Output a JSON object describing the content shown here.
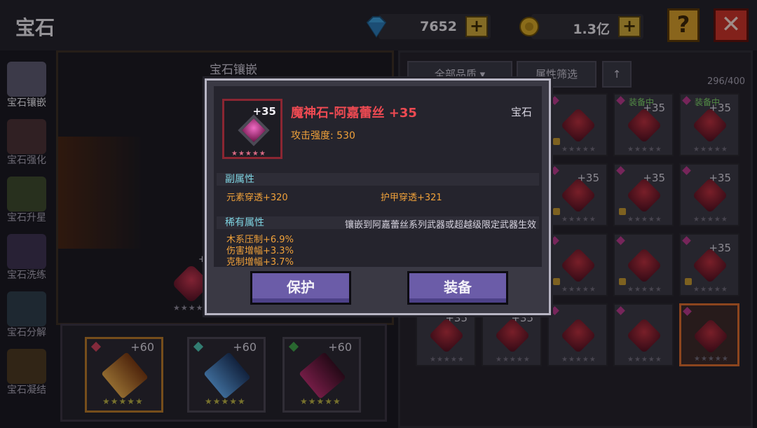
{
  "header": {
    "title": "宝石",
    "diamond": {
      "value": "7652",
      "plus": "+"
    },
    "gold": {
      "value": "1.3亿",
      "plus": "+"
    },
    "help_label": "?",
    "close_label": "✕"
  },
  "sidebar": {
    "items": [
      {
        "label": "宝石镶嵌",
        "active": true
      },
      {
        "label": "宝石强化",
        "active": false
      },
      {
        "label": "宝石升星",
        "active": false
      },
      {
        "label": "宝石洗练",
        "active": false
      },
      {
        "label": "宝石分解",
        "active": false
      },
      {
        "label": "宝石凝结",
        "active": false
      }
    ]
  },
  "left_panel": {
    "title": "宝石镶嵌",
    "slot": {
      "level": "+35",
      "stars": "★★★★★"
    },
    "weapons": [
      {
        "level": "+60",
        "stars": "★★★★★",
        "color": "#e0a44a",
        "gem_color": "#c9415b",
        "selected": true
      },
      {
        "level": "+60",
        "stars": "★★★★★",
        "color": "#5ea3e8",
        "gem_color": "#4ec0b0",
        "selected": false
      },
      {
        "level": "+60",
        "stars": "★★★★★",
        "color": "#b12c6b",
        "gem_color": "#3fa04a",
        "selected": false
      }
    ]
  },
  "right_panel": {
    "filter_quality": "全部品质",
    "filter_attr": "属性筛选",
    "sort_label": "↑",
    "count": "296/400",
    "cells": [
      {
        "level": "",
        "equipped": "",
        "lock": true
      },
      {
        "level": "",
        "equipped": "",
        "lock": true
      },
      {
        "level": "",
        "equipped": "",
        "lock": true
      },
      {
        "level": "+35",
        "equipped": "装备中",
        "lock": false
      },
      {
        "level": "+35",
        "equipped": "装备中",
        "lock": false
      },
      {
        "level": "+35",
        "equipped": "",
        "lock": true
      },
      {
        "level": "+35",
        "equipped": "",
        "lock": false
      },
      {
        "level": "+35",
        "equipped": "",
        "lock": true
      },
      {
        "level": "+35",
        "equipped": "",
        "lock": true
      },
      {
        "level": "+35",
        "equipped": "",
        "lock": false
      },
      {
        "level": "+35",
        "equipped": "",
        "lock": false
      },
      {
        "level": "+35",
        "equipped": "",
        "lock": true
      },
      {
        "level": "",
        "equipped": "",
        "lock": true
      },
      {
        "level": "",
        "equipped": "",
        "lock": true
      },
      {
        "level": "+35",
        "equipped": "",
        "lock": true
      },
      {
        "level": "+35",
        "equipped": "",
        "lock": false
      },
      {
        "level": "+35",
        "equipped": "",
        "lock": false
      },
      {
        "level": "",
        "equipped": "",
        "lock": false
      },
      {
        "level": "",
        "equipped": "",
        "lock": false
      },
      {
        "level": "",
        "equipped": "",
        "lock": false
      }
    ]
  },
  "modal": {
    "item_level": "+35",
    "item_stars": "★★★★★",
    "item_name": "魔神石-阿嘉蕾丝 +35",
    "item_type": "宝石",
    "attack": "攻击强度: 530",
    "sub_attr_title": "副属性",
    "sub_attrs": [
      "元素穿透+320",
      "护甲穿透+321"
    ],
    "rare_attr_title": "稀有属性",
    "rare_note": "镶嵌到阿嘉蕾丝系列武器或超越级限定武器生效",
    "rare_attrs": [
      "木系压制+6.9%",
      "伤害增幅+3.3%",
      "克制增幅+3.7%"
    ],
    "btn_protect": "保护",
    "btn_equip": "装备"
  },
  "colors": {
    "item_name": "#ee4a52",
    "attr": "#f0a13a",
    "section": "#7fd4e2",
    "button": "#6b5ca8"
  }
}
